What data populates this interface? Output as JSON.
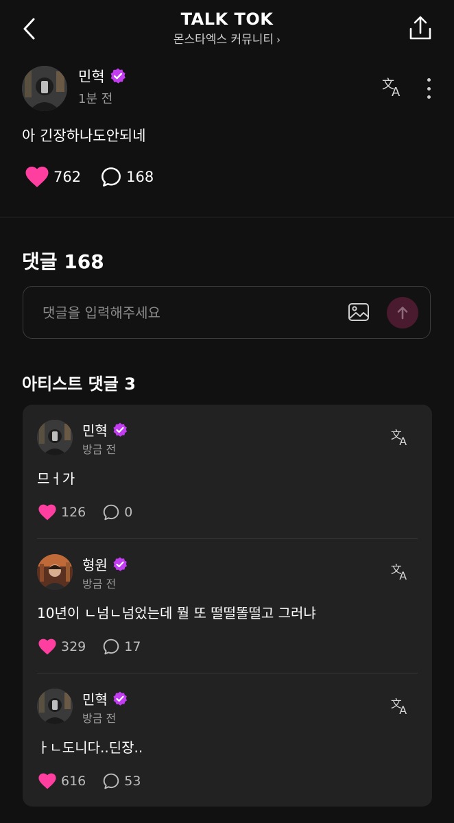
{
  "header": {
    "title": "TALK TOK",
    "community": "몬스타엑스 커뮤니티"
  },
  "post": {
    "author": "민혁",
    "time": "1분 전",
    "text": "아 긴장하나도안되네",
    "likes": "762",
    "comments": "168"
  },
  "comments_section": {
    "title": "댓글 168",
    "input_placeholder": "댓글을 입력해주세요"
  },
  "artist_comments": {
    "title": "아티스트 댓글 3",
    "items": [
      {
        "author": "민혁",
        "time": "방금 전",
        "text": "므ㅓ가",
        "likes": "126",
        "replies": "0"
      },
      {
        "author": "형원",
        "time": "방금 전",
        "text": "10년이 ㄴ넘ㄴ넘었는데 뭘 또 떨떨똘떨고 그러냐",
        "likes": "329",
        "replies": "17"
      },
      {
        "author": "민혁",
        "time": "방금 전",
        "text": "ㅏㄴ도니다..딘장..",
        "likes": "616",
        "replies": "53"
      }
    ]
  },
  "colors": {
    "background": "#111111",
    "card": "#222222",
    "heart": "#ff3fa0",
    "verified": "#c23df0",
    "send_button": "#4a1a2e"
  },
  "icons": [
    "back-icon",
    "share-icon",
    "verified-icon",
    "translate-icon",
    "more-icon",
    "heart-icon",
    "comment-icon",
    "image-icon",
    "send-arrow-icon"
  ]
}
